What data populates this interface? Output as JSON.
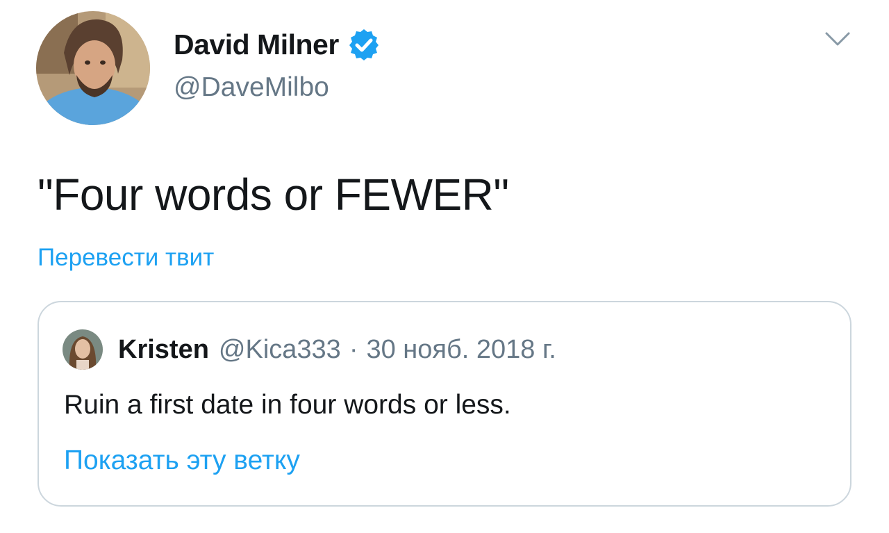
{
  "author": {
    "name": "David Milner",
    "handle": "@DaveMilbo",
    "verified": true,
    "avatar_icon": "avatar-photo"
  },
  "tweet": {
    "text": "\"Four words or FEWER\"",
    "translate_label": "Перевести твит"
  },
  "quoted_tweet": {
    "author_name": "Kristen",
    "author_handle": "@Kica333",
    "separator": "·",
    "date": "30 нояб. 2018 г.",
    "text": "Ruin a first date in four words or less.",
    "show_thread_label": "Показать эту ветку"
  },
  "icons": {
    "verified": "verified-badge-icon",
    "menu": "chevron-down-icon"
  },
  "colors": {
    "link": "#1da1f2",
    "secondary_text": "#657786",
    "primary_text": "#14171a",
    "border": "#ccd6dd",
    "verified": "#1da1f2"
  }
}
